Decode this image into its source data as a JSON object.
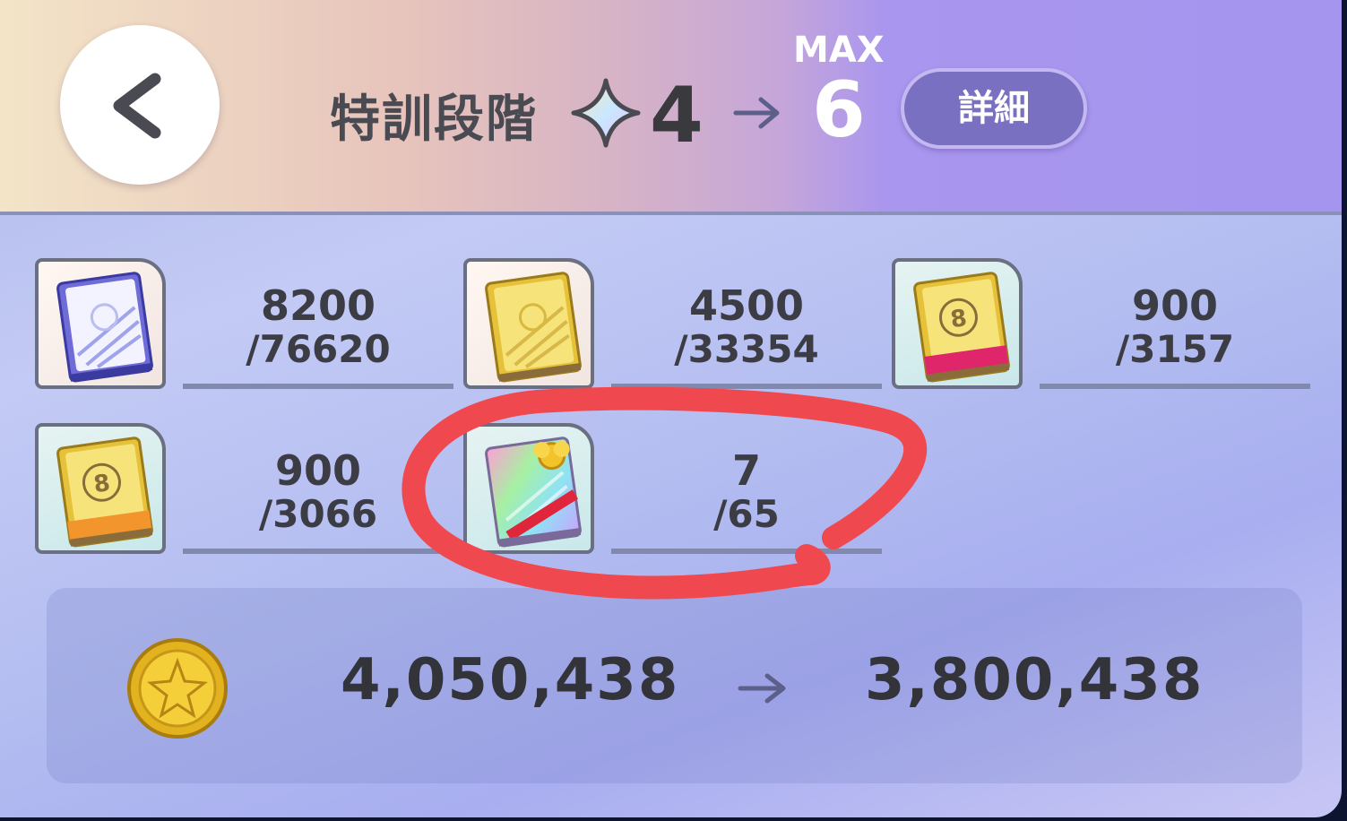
{
  "header": {
    "title": "特訓段階",
    "current_stage": "4",
    "max_label": "MAX",
    "max_stage": "6",
    "detail_button": "詳細"
  },
  "materials": [
    {
      "icon": "blue-book-icon",
      "have": "8200",
      "need": "/76620"
    },
    {
      "icon": "gold-book-icon",
      "have": "4500",
      "need": "/33354"
    },
    {
      "icon": "pink-gold-book-icon",
      "have": "900",
      "need": "/3157"
    },
    {
      "icon": "orange-gold-book-icon",
      "have": "900",
      "need": "/3066"
    },
    {
      "icon": "rainbow-ribbon-book-icon",
      "have": "7",
      "need": "/65"
    }
  ],
  "cost": {
    "icon": "coin-icon",
    "current": "4,050,438",
    "after": "3,800,438"
  },
  "colors": {
    "accent": "#7a70c2",
    "highlight_circle": "#f0484f"
  }
}
